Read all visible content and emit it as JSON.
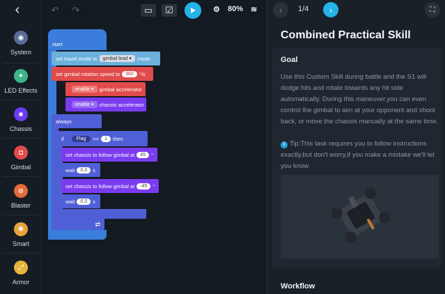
{
  "sidebar": {
    "back_icon": "arrow-left-icon",
    "items": [
      {
        "label": "System",
        "icon": "system-icon",
        "color": "#5a6b9a"
      },
      {
        "label": "LED Effects",
        "icon": "led-icon",
        "color": "#3fb48a"
      },
      {
        "label": "Chassis",
        "icon": "chassis-icon",
        "color": "#6a3df0"
      },
      {
        "label": "Gimbal",
        "icon": "gimbal-icon",
        "color": "#e24b4b"
      },
      {
        "label": "Blaster",
        "icon": "blaster-icon",
        "color": "#e36a3a"
      },
      {
        "label": "Smart",
        "icon": "smart-icon",
        "color": "#e8a23a"
      },
      {
        "label": "Armor",
        "icon": "armor-icon",
        "color": "#e7b43a"
      }
    ]
  },
  "toolbar": {
    "undo_icon": "undo-icon",
    "redo_icon": "redo-icon",
    "screen_icon": "screen-icon",
    "clipboard_icon": "clipboard-icon",
    "run_icon": "play-icon",
    "battery": "80%",
    "wifi_icon": "wifi-icon",
    "robot_icon": "robot-icon",
    "accent": "#23b3e8"
  },
  "blocks": {
    "start": "start",
    "set_travel": "set travel mode to",
    "travel_value": "gimbal lead",
    "travel_mode": "mode",
    "set_speed": "set gimbal rotation speed to",
    "speed_value": "360",
    "speed_unit": "°/s",
    "enable1": "enable",
    "gimbal_acc": "gimbal accelerator",
    "enable2": "enable",
    "chassis_acc": "chassis accelerator",
    "always": "always",
    "if_kw": "if",
    "flag": "Flag",
    "eq": "==",
    "flag_val": "1",
    "then": "then",
    "follow1": "set chassis to follow gimbal at",
    "angle1": "45",
    "deg1": "°",
    "wait1": "wait",
    "wait1_val": "0.3",
    "wait1_unit": "s",
    "follow2": "set chassis to follow gimbal at",
    "angle2": "-45",
    "deg2": "°",
    "wait2": "wait",
    "wait2_val": "0.3",
    "wait2_unit": "s",
    "loop_icon": "loop-icon"
  },
  "panel": {
    "prev_icon": "chevron-left-icon",
    "next_icon": "chevron-right-icon",
    "fullscreen_icon": "fullscreen-icon",
    "page": "1/4",
    "title": "Combined Practical Skill",
    "goal_heading": "Goal",
    "goal_text": "Use this Custom Skill during battle and the S1 will dodge hits and rotate towards any hit side automatically. During this maneuver,you can even control the gimbal to aim at your opponent and shoot back, or move the chassis manually at the same time.",
    "tip_icon": "info-icon",
    "tip_text": "Tip:This task requires you to follow instructions exactly,but don't worry,if you make a mistake we'll let you know.",
    "image_desc": "robot-image",
    "workflow_heading": "Workflow"
  }
}
